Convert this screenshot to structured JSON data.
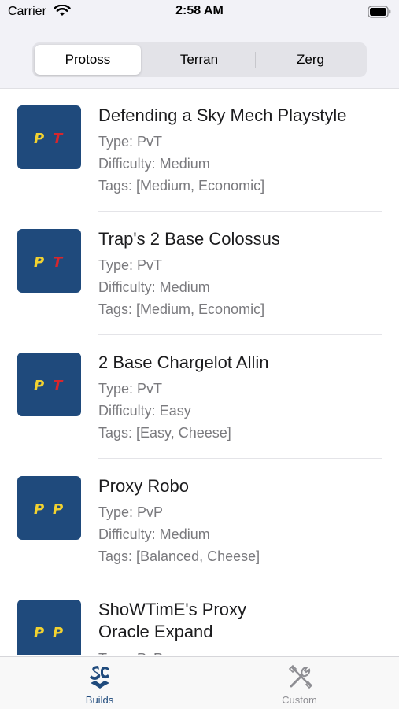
{
  "status_bar": {
    "carrier": "Carrier",
    "time": "2:58 AM"
  },
  "segments": [
    {
      "label": "Protoss",
      "selected": true
    },
    {
      "label": "Terran",
      "selected": false
    },
    {
      "label": "Zerg",
      "selected": false
    }
  ],
  "builds": [
    {
      "title": "Defending a Sky Mech Playstyle",
      "type": "Type: PvT",
      "difficulty": "Difficulty: Medium",
      "tags": "Tags: [Medium, Economic]",
      "icon_letters": [
        "P",
        "T"
      ]
    },
    {
      "title": "Trap's 2 Base Colossus",
      "type": "Type: PvT",
      "difficulty": "Difficulty: Medium",
      "tags": "Tags: [Medium, Economic]",
      "icon_letters": [
        "P",
        "T"
      ]
    },
    {
      "title": "2 Base Chargelot Allin",
      "type": "Type: PvT",
      "difficulty": "Difficulty: Easy",
      "tags": "Tags: [Easy, Cheese]",
      "icon_letters": [
        "P",
        "T"
      ]
    },
    {
      "title": "Proxy Robo",
      "type": "Type: PvP",
      "difficulty": "Difficulty: Medium",
      "tags": "Tags: [Balanced, Cheese]",
      "icon_letters": [
        "P",
        "P"
      ]
    },
    {
      "title_lines": [
        "ShoWTimE's Proxy",
        "Oracle Expand"
      ],
      "type": "Type: PvP",
      "icon_letters": [
        "P",
        "P"
      ]
    }
  ],
  "tabbar": {
    "items": [
      {
        "label": "Builds",
        "icon": "sc-logo-icon",
        "selected": true
      },
      {
        "label": "Custom",
        "icon": "tools-icon",
        "selected": false
      }
    ]
  },
  "colors": {
    "accent": "#1f4a7c",
    "thumb_bg": "#1f4a7c",
    "protoss_letter": "#f2d230",
    "terran_letter": "#d8262c",
    "secondary_text": "#7a7a7e",
    "tab_inactive": "#8e8e93"
  }
}
